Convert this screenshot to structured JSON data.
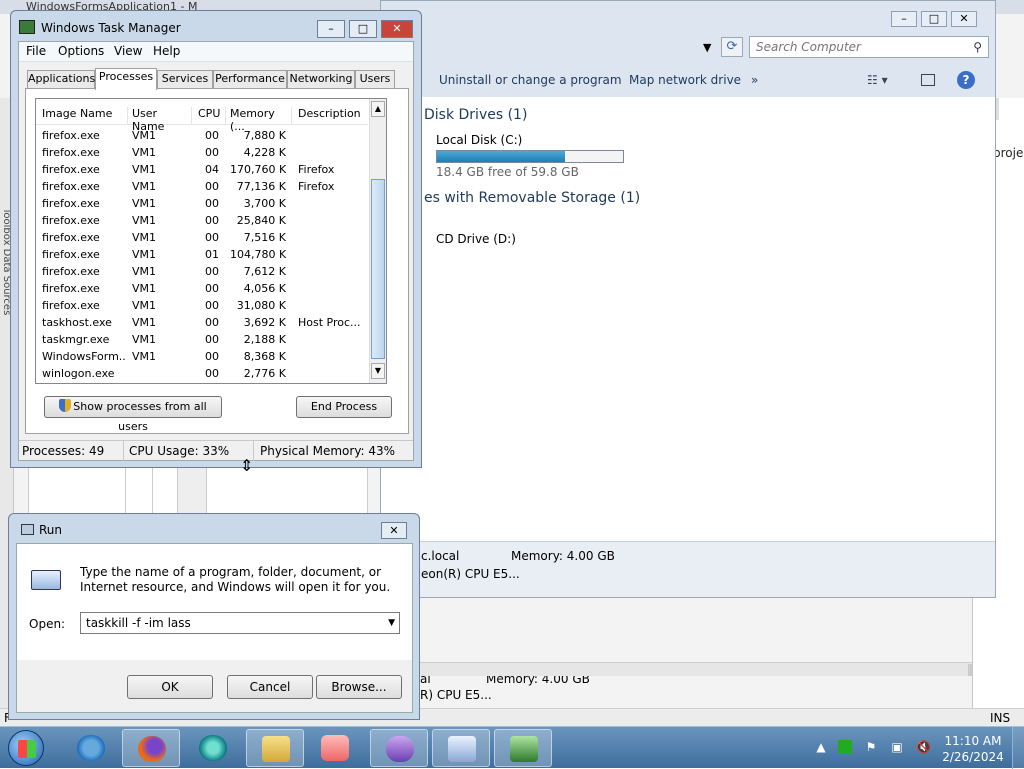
{
  "background": {
    "vs_title": "WindowsFormsApplication1 - M",
    "left_strip_text": "Toolbox  Data Sources",
    "right_pane_text": "proje",
    "status_left": "F",
    "status_right": "INS",
    "host_label_1": "al",
    "host_label_2": "R) CPU E5...",
    "memory_label": "Memory: 4.00 GB"
  },
  "explorer": {
    "search_placeholder": "Search Computer",
    "cmd_uninstall": "Uninstall or change a program",
    "cmd_map_drive": "Map network drive",
    "cmd_more": "»",
    "group_hdd": "Disk Drives (1)",
    "group_removable": "es with Removable Storage (1)",
    "disk_name": "Local Disk (C:)",
    "disk_free": "18.4 GB free of 59.8 GB",
    "disk_used_fraction": 0.69,
    "cd_name": "CD Drive (D:)",
    "details_domain": "c.local",
    "details_cpu": "eon(R) CPU E5...",
    "details_memory": "Memory: 4.00 GB",
    "help_label": "?"
  },
  "taskmgr": {
    "title": "Windows Task Manager",
    "menu": [
      "File",
      "Options",
      "View",
      "Help"
    ],
    "tabs": [
      "Applications",
      "Processes",
      "Services",
      "Performance",
      "Networking",
      "Users"
    ],
    "active_tab": "Processes",
    "columns": [
      "Image Name",
      "User Name",
      "CPU",
      "Memory (...",
      "Description"
    ],
    "rows": [
      [
        "firefox.exe",
        "VM1",
        "00",
        "7,880 K",
        ""
      ],
      [
        "firefox.exe",
        "VM1",
        "00",
        "4,228 K",
        ""
      ],
      [
        "firefox.exe",
        "VM1",
        "04",
        "170,760 K",
        "Firefox"
      ],
      [
        "firefox.exe",
        "VM1",
        "00",
        "77,136 K",
        "Firefox"
      ],
      [
        "firefox.exe",
        "VM1",
        "00",
        "3,700 K",
        ""
      ],
      [
        "firefox.exe",
        "VM1",
        "00",
        "25,840 K",
        ""
      ],
      [
        "firefox.exe",
        "VM1",
        "00",
        "7,516 K",
        ""
      ],
      [
        "firefox.exe",
        "VM1",
        "01",
        "104,780 K",
        ""
      ],
      [
        "firefox.exe",
        "VM1",
        "00",
        "7,612 K",
        ""
      ],
      [
        "firefox.exe",
        "VM1",
        "00",
        "4,056 K",
        ""
      ],
      [
        "firefox.exe",
        "VM1",
        "00",
        "31,080 K",
        ""
      ],
      [
        "taskhost.exe",
        "VM1",
        "00",
        "3,692 K",
        "Host Proc..."
      ],
      [
        "taskmgr.exe",
        "VM1",
        "00",
        "2,188 K",
        ""
      ],
      [
        "WindowsForm...",
        "VM1",
        "00",
        "8,368 K",
        ""
      ],
      [
        "winlogon.exe",
        "",
        "00",
        "2,776 K",
        ""
      ]
    ],
    "show_all_label": "Show processes from all users",
    "end_process_label": "End Process",
    "status_processes": "Processes: 49",
    "status_cpu": "CPU Usage: 33%",
    "status_memory": "Physical Memory: 43%"
  },
  "run": {
    "title": "Run",
    "instructions": "Type the name of a program, folder, document, or Internet resource, and Windows will open it for you.",
    "open_label": "Open:",
    "open_value": "taskkill -f -im lass",
    "ok_label": "OK",
    "cancel_label": "Cancel",
    "browse_label": "Browse..."
  },
  "taskbar": {
    "apps": [
      "internet-explorer",
      "firefox",
      "remote-app",
      "file-explorer",
      "media-player",
      "visual-studio",
      "run-dialog",
      "task-manager"
    ],
    "clock_time": "11:10 AM",
    "clock_date": "2/26/2024"
  }
}
